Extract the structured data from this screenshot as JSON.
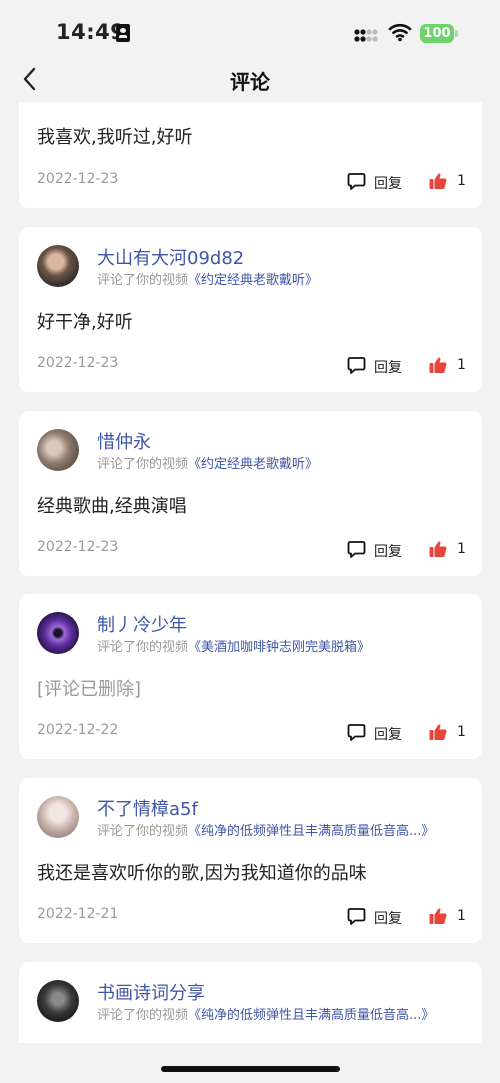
{
  "status_bar": {
    "time": "14:49",
    "battery": "100"
  },
  "nav": {
    "title": "评论",
    "back_icon": "chevron-left-icon"
  },
  "colors": {
    "background": "#f2f2f2",
    "link_blue": "#3f56a8",
    "like_red": "#e8453c",
    "battery_green": "#6fd36b"
  },
  "reply_label": "回复",
  "commented_prefix": "评论了你的视频",
  "comments": [
    {
      "name": "",
      "video": "",
      "text": "我喜欢,我听过,好听",
      "date": "2022-12-23",
      "likes": "1",
      "avatar": "none"
    },
    {
      "name": "大山有大河09d82",
      "video": "《约定经典老歌戴听》",
      "text": "好干净,好听",
      "date": "2022-12-23",
      "likes": "1",
      "avatar": "photo-couple"
    },
    {
      "name": "惜仲永",
      "video": "《约定经典老歌戴听》",
      "text": "经典歌曲,经典演唱",
      "date": "2022-12-23",
      "likes": "1",
      "avatar": "photo-portrait"
    },
    {
      "name": "制丿冷少年",
      "video": "《美酒加咖啡钟志刚完美脱箱》",
      "text": "[评论已删除]",
      "date": "2022-12-22",
      "likes": "1",
      "avatar": "purple-eye",
      "deleted": true
    },
    {
      "name": "不了情樟a5f",
      "video": "《纯净的低频弹性且丰满高质量低音高...》",
      "text": "我还是喜欢听你的歌,因为我知道你的品味",
      "date": "2022-12-21",
      "likes": "1",
      "avatar": "photo-group"
    },
    {
      "name": "书画诗词分享",
      "video": "《纯净的低频弹性且丰满高质量低音高...》",
      "text": "",
      "date": "",
      "likes": "",
      "avatar": "photo-dark"
    }
  ]
}
